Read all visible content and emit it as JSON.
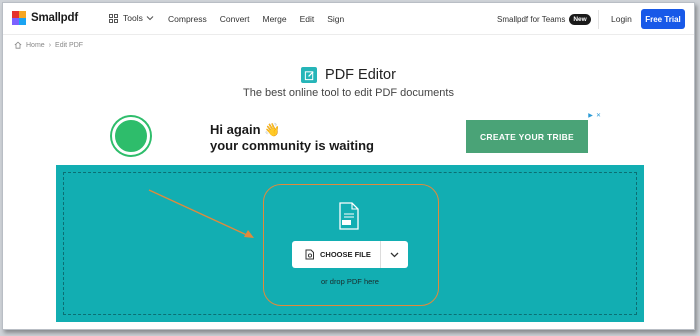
{
  "nav": {
    "brand": "Smallpdf",
    "tools_label": "Tools",
    "links": [
      "Compress",
      "Convert",
      "Merge",
      "Edit",
      "Sign"
    ],
    "teams_label": "Smallpdf for Teams",
    "teams_badge": "New",
    "login_label": "Login",
    "trial_label": "Free Trial"
  },
  "breadcrumb": {
    "home": "Home",
    "separator": "›",
    "current": "Edit PDF"
  },
  "page": {
    "title": "PDF Editor",
    "subtitle": "The best online tool to edit PDF documents"
  },
  "ad": {
    "line1": "Hi again 👋",
    "line2": "your community is waiting",
    "cta": "CREATE YOUR TRIBE",
    "button_color": "#4aa377"
  },
  "upload": {
    "choose_label": "CHOOSE FILE",
    "drop_text": "or drop PDF here",
    "zone_color": "#12aeb2"
  },
  "colors": {
    "accent": "#1859e8",
    "highlight": "#e08a3c",
    "teal": "#26b5b8"
  },
  "icons": [
    "smallpdf-logo-icon",
    "grid-icon",
    "chevron-down-icon",
    "home-icon",
    "edit-icon",
    "pdf-file-icon",
    "file-search-icon",
    "adchoices-icon",
    "close-icon"
  ]
}
